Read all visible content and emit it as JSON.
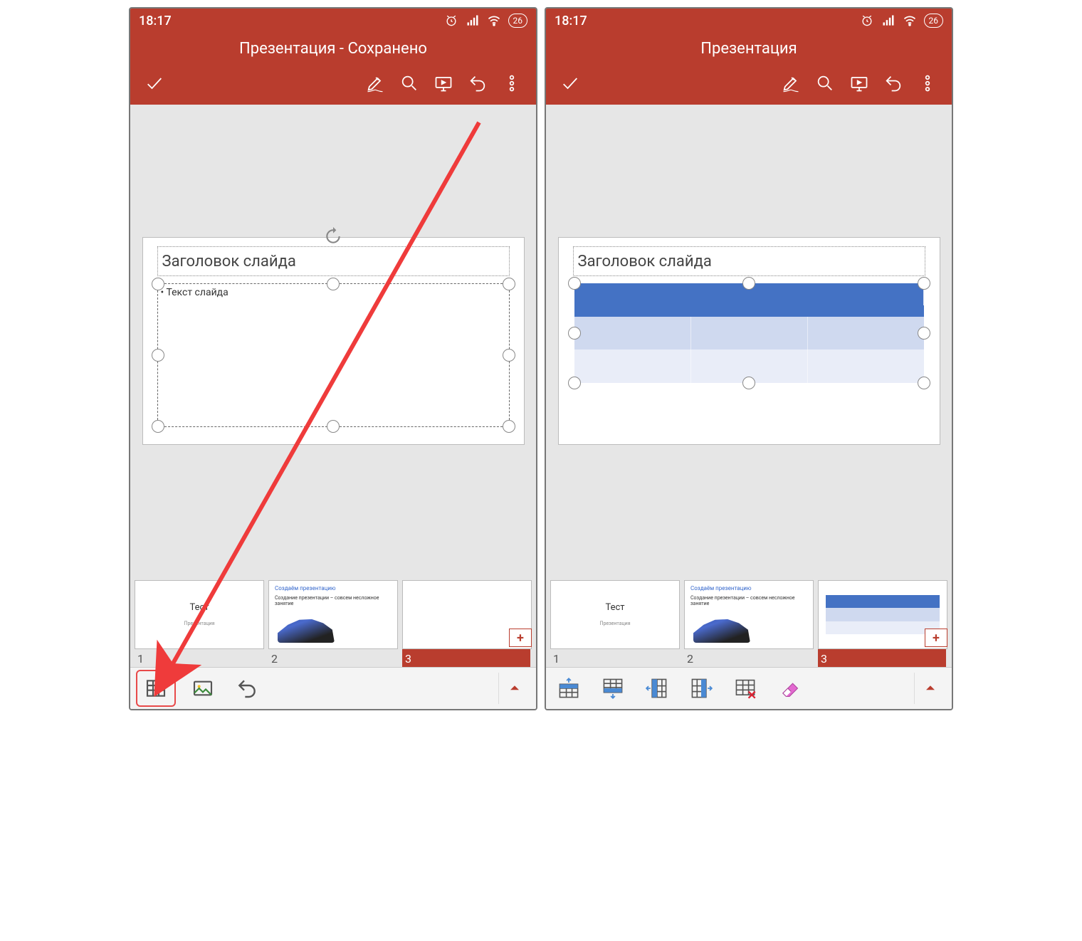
{
  "statusbar": {
    "time": "18:17",
    "battery": "26"
  },
  "left": {
    "title": "Презентация - Сохранено",
    "slide": {
      "title_placeholder": "Заголовок слайда",
      "body_placeholder": "Текст слайда"
    },
    "thumbs": {
      "1": {
        "num": "1",
        "title": "Тест",
        "subtitle": "Презентация"
      },
      "2": {
        "num": "2",
        "link": "Создаём презентацию",
        "line": "Создание презентации – совсем несложное занятие"
      },
      "3": {
        "num": "3"
      }
    }
  },
  "right": {
    "title": "Презентация",
    "slide": {
      "title_placeholder": "Заголовок слайда"
    },
    "thumbs": {
      "1": {
        "num": "1",
        "title": "Тест",
        "subtitle": "Презентация"
      },
      "2": {
        "num": "2",
        "link": "Создаём презентацию",
        "line": "Создание презентации – совсем несложное занятие"
      },
      "3": {
        "num": "3"
      }
    }
  },
  "add_slide_label": "+"
}
